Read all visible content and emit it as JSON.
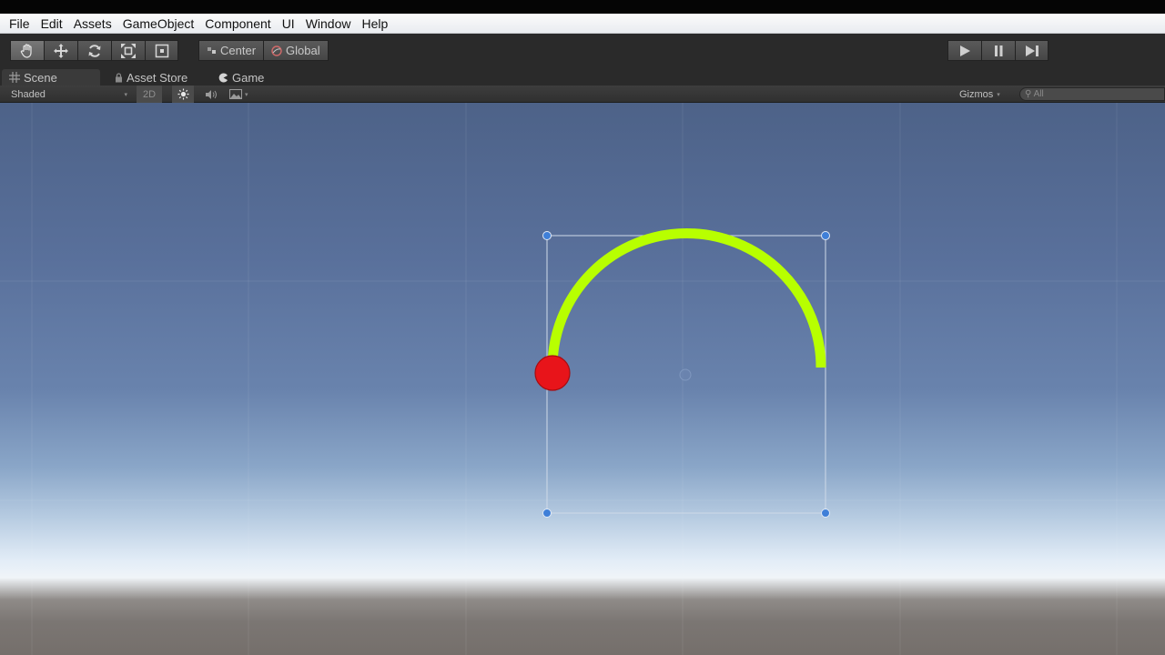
{
  "menu": [
    "File",
    "Edit",
    "Assets",
    "GameObject",
    "Component",
    "UI",
    "Window",
    "Help"
  ],
  "toolbar": {
    "tools": [
      "hand-tool",
      "move-tool",
      "rotate-tool",
      "scale-tool",
      "rect-tool"
    ],
    "pivot_label": "Center",
    "space_label": "Global",
    "playback": [
      "play",
      "pause",
      "step"
    ]
  },
  "tabs": {
    "scene": "Scene",
    "asset_store": "Asset Store",
    "game": "Game"
  },
  "scene_toolbar": {
    "draw_mode": "Shaded",
    "mode_2d": "2D",
    "gizmos_label": "Gizmos",
    "search_placeholder": "All"
  },
  "colors": {
    "arc": "#b8ff00",
    "ball": "#e8141a",
    "handle": "#3f7fd8",
    "menu_bg": "#eff1f4",
    "toolbar_bg": "#2a2a2a"
  }
}
